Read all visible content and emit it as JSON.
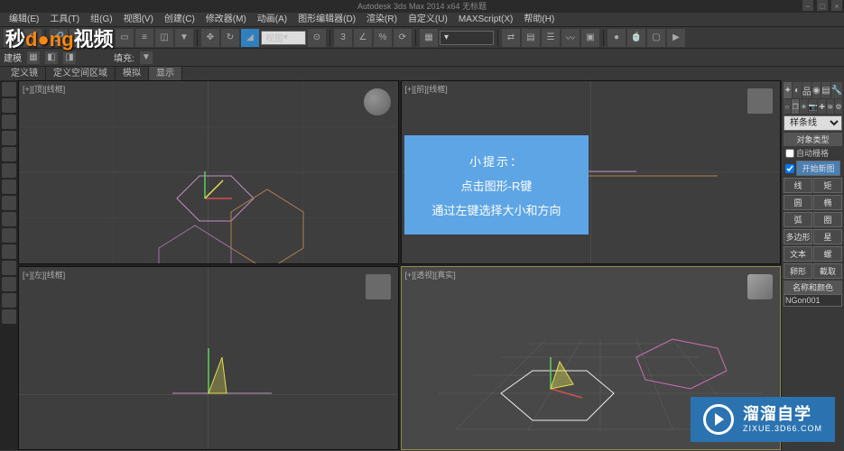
{
  "title": "Autodesk 3ds Max 2014 x64   无标题",
  "menus": [
    "编辑(E)",
    "工具(T)",
    "组(G)",
    "视图(V)",
    "创建(C)",
    "修改器(M)",
    "动画(A)",
    "图形编辑器(D)",
    "渲染(R)",
    "自定义(U)",
    "MAXScript(X)",
    "帮助(H)"
  ],
  "toolbar": {
    "combo1": "视图",
    "combo2": ""
  },
  "toolbar2": {
    "fill_label": "填充:"
  },
  "tabs": [
    "定义镜",
    "定义空间区域",
    "模拟",
    "显示"
  ],
  "build_label": "建模",
  "viewports": {
    "top_left": "[+][顶][线框]",
    "top_right": "[+][前][线框]",
    "bottom_left": "[+][左][线框]",
    "bottom_right": "[+][透视][真实]"
  },
  "watermark_left": {
    "brand": "秒",
    "dong": "d",
    "dong2": "ng",
    "rest": "视频"
  },
  "tip": {
    "title": "小提示：",
    "line1": "点击图形-R键",
    "line2": "通过左键选择大小和方向"
  },
  "watermark_right": {
    "brand": "溜溜自学",
    "url": "ZIXUE.3D66.COM"
  },
  "command_panel": {
    "shape_combo": "样条线",
    "rollout1": "对象类型",
    "auto_grid": "自动栅格",
    "start_new": "开始新图",
    "buttons": [
      "线",
      "矩",
      "圆",
      "椭",
      "弧",
      "圈",
      "多边形",
      "星",
      "文本",
      "螺",
      "卵形",
      "截取"
    ],
    "rollout2": "名称和颜色",
    "name_value": "NGon001"
  }
}
